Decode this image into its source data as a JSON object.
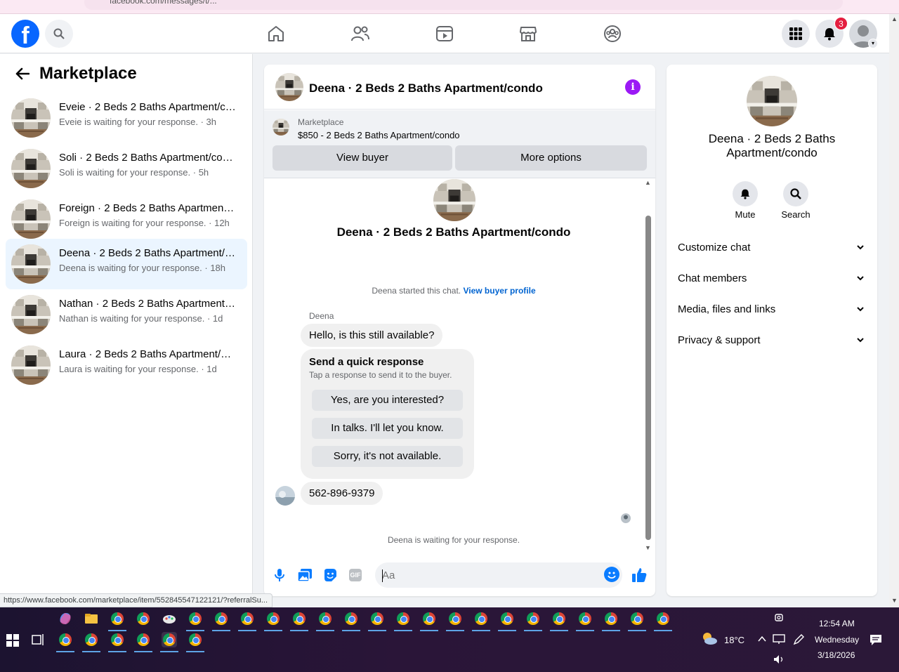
{
  "browser": {
    "url_fragment": "facebook.com/messages/t/..."
  },
  "topnav": {
    "logo": "f",
    "notification_count": "3"
  },
  "sidebar": {
    "title": "Marketplace",
    "conversations": [
      {
        "name": "Eveie · 2 Beds 2 Baths Apartment/condo",
        "sub": "Eveie is waiting for your response. · 3h",
        "active": false
      },
      {
        "name": "Soli · 2 Beds 2 Baths Apartment/condo",
        "sub": "Soli is waiting for your response. · 5h",
        "active": false
      },
      {
        "name": "Foreign · 2 Beds 2 Baths Apartment/condo",
        "sub": "Foreign is waiting for your response. · 12h",
        "active": false
      },
      {
        "name": "Deena · 2 Beds 2 Baths Apartment/condo",
        "sub": "Deena is waiting for your response. · 18h",
        "active": true
      },
      {
        "name": "Nathan · 2 Beds 2 Baths Apartment/condo",
        "sub": "Nathan is waiting for your response. · 1d",
        "active": false
      },
      {
        "name": "Laura · 2 Beds 2 Baths Apartment/condo",
        "sub": "Laura is waiting for your response. · 1d",
        "active": false
      }
    ]
  },
  "chat": {
    "title": "Deena · 2 Beds 2 Baths Apartment/condo",
    "marketplace_label": "Marketplace",
    "listing": "$850 - 2 Beds 2 Baths Apartment/condo",
    "view_buyer": "View buyer",
    "more_options": "More options",
    "intro_title": "Deena · 2 Beds 2 Baths Apartment/condo",
    "started_text": "Deena started this chat.",
    "view_buyer_profile": "View buyer profile",
    "sender": "Deena",
    "message1": "Hello, is this still available?",
    "quick_response": {
      "heading": "Send a quick response",
      "subtitle": "Tap a response to send it to the buyer.",
      "options": [
        "Yes, are you interested?",
        "In talks. I'll let you know.",
        "Sorry, it's not available."
      ]
    },
    "message2": "562-896-9379",
    "waiting": "Deena is waiting for your response.",
    "composer_placeholder": "Aa"
  },
  "details": {
    "name": "Deena · 2 Beds 2 Baths Apartment/condo",
    "mute": "Mute",
    "search": "Search",
    "rows": [
      "Customize chat",
      "Chat members",
      "Media, files and links",
      "Privacy & support"
    ]
  },
  "status_url": "https://www.facebook.com/marketplace/item/552845547122121/?referralSu...",
  "taskbar": {
    "temperature": "18°C",
    "time": "12:54 AM",
    "day": "Wednesday",
    "date": "3/18/2026"
  },
  "colors": {
    "fb_blue": "#0866ff",
    "accent_purple": "#9b19f5",
    "active_row": "#ebf5ff",
    "badge_red": "#e41e3f"
  }
}
